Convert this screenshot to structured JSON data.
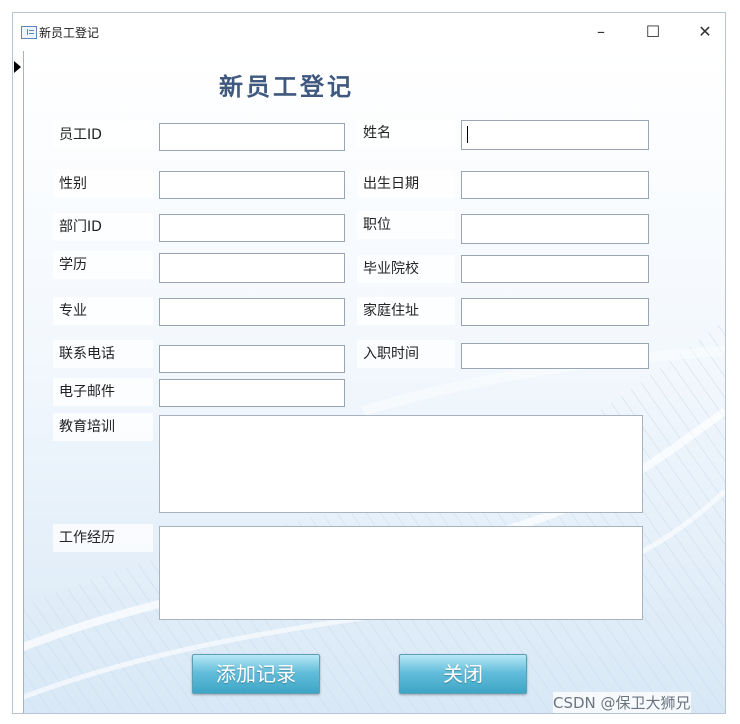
{
  "window": {
    "title": "新员工登记",
    "minimize_glyph": "–",
    "maximize_glyph": "☐",
    "close_glyph": "✕"
  },
  "form": {
    "heading": "新员工登记",
    "fields": {
      "employee_id": {
        "label": "员工ID",
        "value": ""
      },
      "name": {
        "label": "姓名",
        "value": ""
      },
      "gender": {
        "label": "性别",
        "value": ""
      },
      "birth_date": {
        "label": "出生日期",
        "value": ""
      },
      "department_id": {
        "label": "部门ID",
        "value": ""
      },
      "position": {
        "label": "职位",
        "value": ""
      },
      "education": {
        "label": "学历",
        "value": ""
      },
      "graduated_school": {
        "label": "毕业院校",
        "value": ""
      },
      "major": {
        "label": "专业",
        "value": ""
      },
      "home_address": {
        "label": "家庭住址",
        "value": ""
      },
      "phone": {
        "label": "联系电话",
        "value": ""
      },
      "hire_date": {
        "label": "入职时间",
        "value": ""
      },
      "email": {
        "label": "电子邮件",
        "value": ""
      },
      "training": {
        "label": "教育培训",
        "value": ""
      },
      "work_history": {
        "label": "工作经历",
        "value": ""
      }
    },
    "buttons": {
      "add_record": "添加记录",
      "close": "关闭"
    }
  },
  "watermark": "CSDN @保卫大狮兄",
  "colors": {
    "title": "#3e587e",
    "button": "#3da5c6",
    "background_accent": "#d8e8f6"
  }
}
